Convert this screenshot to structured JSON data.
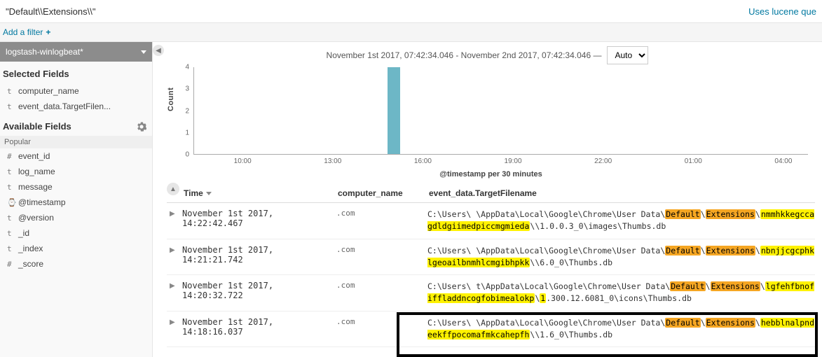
{
  "query": "\"Default\\\\Extensions\\\\\"",
  "lucene_link": "Uses lucene que",
  "add_filter": "Add a filter",
  "index_pattern": "logstash-winlogbeat*",
  "sidebar": {
    "selected_title": "Selected Fields",
    "selected": [
      {
        "t": "t",
        "name": "computer_name"
      },
      {
        "t": "t",
        "name": "event_data.TargetFilen..."
      }
    ],
    "available_title": "Available Fields",
    "popular_title": "Popular",
    "popular": [
      {
        "t": "#",
        "name": "event_id"
      },
      {
        "t": "t",
        "name": "log_name"
      },
      {
        "t": "t",
        "name": "message"
      },
      {
        "t": "⌚",
        "name": "@timestamp"
      },
      {
        "t": "t",
        "name": "@version"
      },
      {
        "t": "t",
        "name": "_id"
      },
      {
        "t": "t",
        "name": "_index"
      },
      {
        "t": "#",
        "name": "_score"
      }
    ]
  },
  "timerange": "November 1st 2017, 07:42:34.046 - November 2nd 2017, 07:42:34.046 —",
  "interval": "Auto",
  "chart_data": {
    "type": "bar",
    "ylabel": "Count",
    "ylim": [
      0,
      4
    ],
    "yticks": [
      0,
      1,
      2,
      3,
      4
    ],
    "xlabel": "@timestamp per 30 minutes",
    "xticks": [
      "10:00",
      "13:00",
      "16:00",
      "19:00",
      "22:00",
      "01:00",
      "04:00"
    ],
    "bars": [
      {
        "x_pct": 31.5,
        "value": 4
      }
    ]
  },
  "columns": {
    "time": "Time",
    "computer": "computer_name",
    "file": "event_data.TargetFilename"
  },
  "rows": [
    {
      "time": "November 1st 2017, 14:22:42.467",
      "comp": ".com",
      "file": {
        "p1": "C:\\Users\\",
        "gap1": "        ",
        "p2": "\\AppData\\Local\\Google\\Chrome\\User Data\\",
        "d": "Default",
        "e": "Extensions",
        "ext": "nmmhkkegccagdldgiimedpiccmgmieda",
        "tail": "\\1.0.0.3_0\\images\\Thumbs.db"
      }
    },
    {
      "time": "November 1st 2017, 14:21:21.742",
      "comp": ".com",
      "file": {
        "p1": "C:\\Users\\",
        "gap1": "        ",
        "p2": "\\AppData\\Local\\Google\\Chrome\\User Data\\",
        "d": "Default",
        "e": "Extensions",
        "ext": "nbnjjcgcphklgeoailbnmhlcmgibhpkk",
        "tail": "\\6.0_0\\Thumbs.db"
      }
    },
    {
      "time": "November 1st 2017, 14:20:32.722",
      "comp": ".com",
      "file": {
        "p1": "C:\\Users\\",
        "gap1": "       t",
        "p2": "\\AppData\\Local\\Google\\Chrome\\User Data\\",
        "d": "Default",
        "e": "Extensions",
        "ext": "lgfehfbnofiffladdncogfobimealokp",
        "extra": "1",
        "tail": ".300.12.6081_0\\icons\\Thumbs.db"
      }
    },
    {
      "time": "November 1st 2017, 14:18:16.037",
      "comp": ".com",
      "file": {
        "p1": "C:\\Users\\",
        "gap1": "        ",
        "p2": "\\AppData\\Local\\Google\\Chrome\\User Data\\",
        "d": "Default",
        "e": "Extensions",
        "ext": "hebblnalpndeekffpocomafmkcahepfh",
        "tail": "\\1.6_0\\Thumbs.db"
      }
    }
  ]
}
